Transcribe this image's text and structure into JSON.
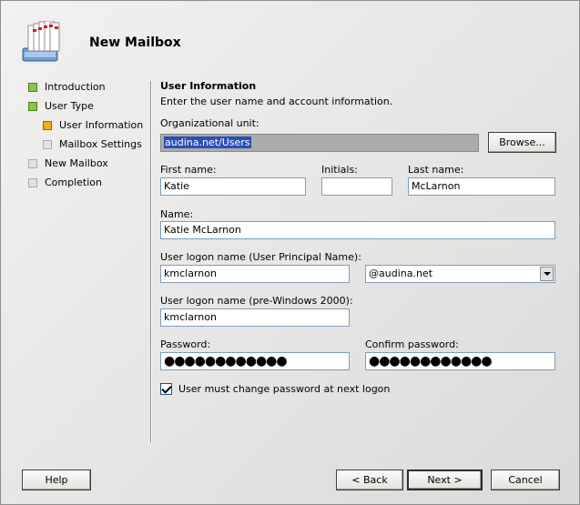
{
  "window": {
    "title": "New Mailbox"
  },
  "nav": [
    {
      "label": "Introduction",
      "status": "green"
    },
    {
      "label": "User Type",
      "status": "green"
    },
    {
      "label": "User Information",
      "status": "yellow"
    },
    {
      "label": "Mailbox Settings",
      "status": "gray"
    },
    {
      "label": "New Mailbox",
      "status": "gray"
    },
    {
      "label": "Completion",
      "status": "gray"
    }
  ],
  "page": {
    "heading": "User Information",
    "description": "Enter the user name and account information."
  },
  "form": {
    "ou_label": "Organizational unit:",
    "ou_value": "audina.net/Users",
    "browse_label": "Browse...",
    "first_label": "First name:",
    "first_value": "Katie",
    "initials_label": "Initials:",
    "initials_value": "",
    "last_label": "Last name:",
    "last_value": "McLarnon",
    "name_label": "Name:",
    "name_value": "Katie McLarnon",
    "upn_label": "User logon name (User Principal Name):",
    "upn_value": "kmclarnon",
    "domain_value": "@audina.net",
    "pre2000_label": "User logon name (pre-Windows 2000):",
    "pre2000_value": "kmclarnon",
    "password_label": "Password:",
    "password_value": "●●●●●●●●●●●●",
    "confirm_label": "Confirm password:",
    "confirm_value": "●●●●●●●●●●●●",
    "must_change_label": "User must change password at next logon",
    "must_change_checked": true
  },
  "buttons": {
    "help": "Help",
    "back": "< Back",
    "next": "Next >",
    "cancel": "Cancel"
  },
  "icons": {
    "logo": "mailbox-stack-icon",
    "checkbox": "check-icon"
  }
}
